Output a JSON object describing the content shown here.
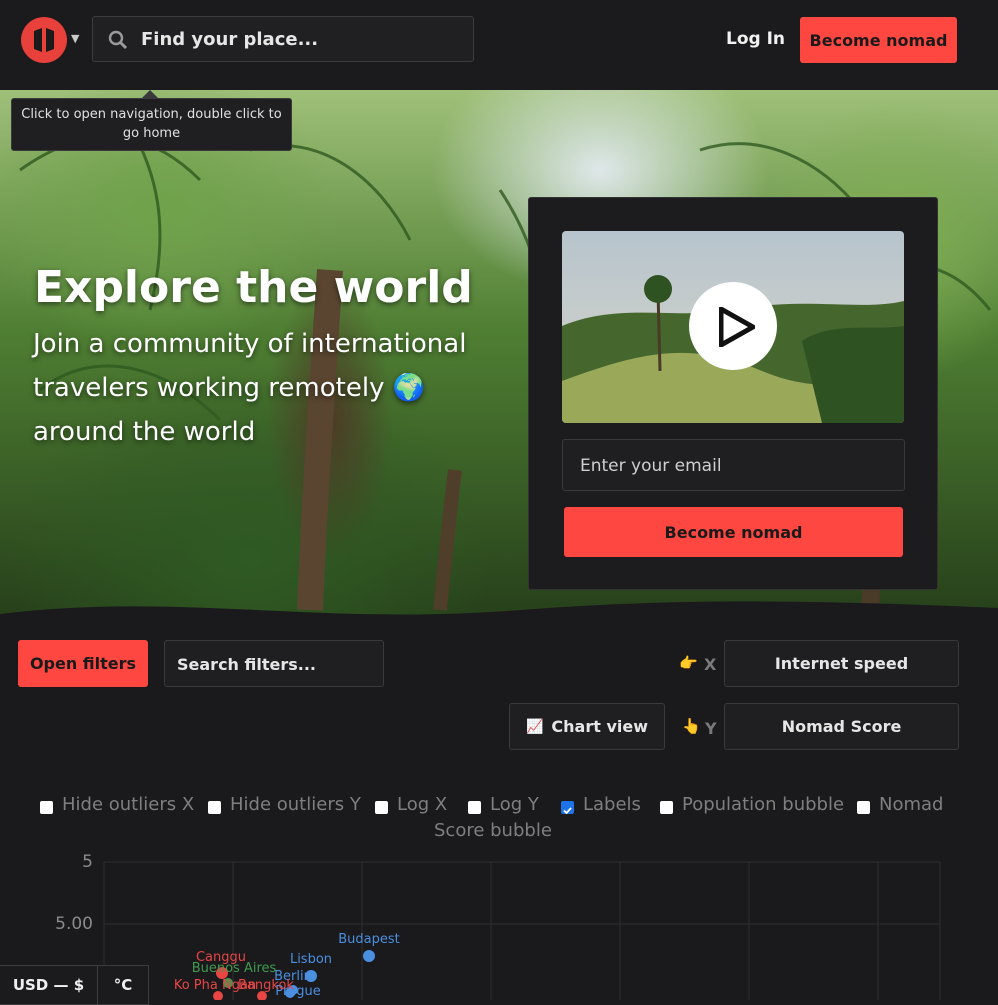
{
  "header": {
    "search_placeholder": "Find your place...",
    "login_label": "Log In",
    "become_nomad_label": "Become nomad",
    "tooltip": "Click to open navigation, double click to go home",
    "logo_icon": "nomad-logo-icon",
    "accent_color": "#ff4742"
  },
  "hero": {
    "title": "Explore the world",
    "subtitle": "Join a community of international travelers working remotely 🌍 around the world",
    "email_placeholder": "Enter your email",
    "signup_label": "Become nomad"
  },
  "filters": {
    "open_label": "Open filters",
    "search_placeholder": "Search filters...",
    "x_emoji": "👉",
    "x_label": "X",
    "x_value": "Internet speed",
    "chart_view_emoji": "📈",
    "chart_view_label": "Chart view",
    "y_emoji": "👆",
    "y_label": "Y",
    "y_value": "Nomad Score"
  },
  "toggles": [
    {
      "label": "Hide outliers X",
      "checked": false
    },
    {
      "label": "Hide outliers Y",
      "checked": false
    },
    {
      "label": "Log X",
      "checked": false
    },
    {
      "label": "Log Y",
      "checked": false
    },
    {
      "label": "Labels",
      "checked": true
    },
    {
      "label": "Population bubble",
      "checked": false
    },
    {
      "label": "Nomad",
      "checked": false
    }
  ],
  "toggle_wrap": "Score bubble",
  "chart_data": {
    "type": "scatter",
    "y_ticks": [
      "5",
      "5.00"
    ],
    "points": [
      {
        "label": "Budapest",
        "color": "#4a8fe0"
      },
      {
        "label": "Lisbon",
        "color": "#4a8fe0"
      },
      {
        "label": "Berlin",
        "color": "#4a8fe0"
      },
      {
        "label": "Prague",
        "color": "#4a8fe0"
      },
      {
        "label": "Canggu",
        "color": "#e84545"
      },
      {
        "label": "Buenos Aires",
        "color": "#3f9a4e"
      },
      {
        "label": "Ko Pha Ngan",
        "color": "#e84545"
      },
      {
        "label": "Bangkok",
        "color": "#e84545"
      }
    ]
  },
  "footer": {
    "currency": "USD — $",
    "unit": "°C"
  }
}
